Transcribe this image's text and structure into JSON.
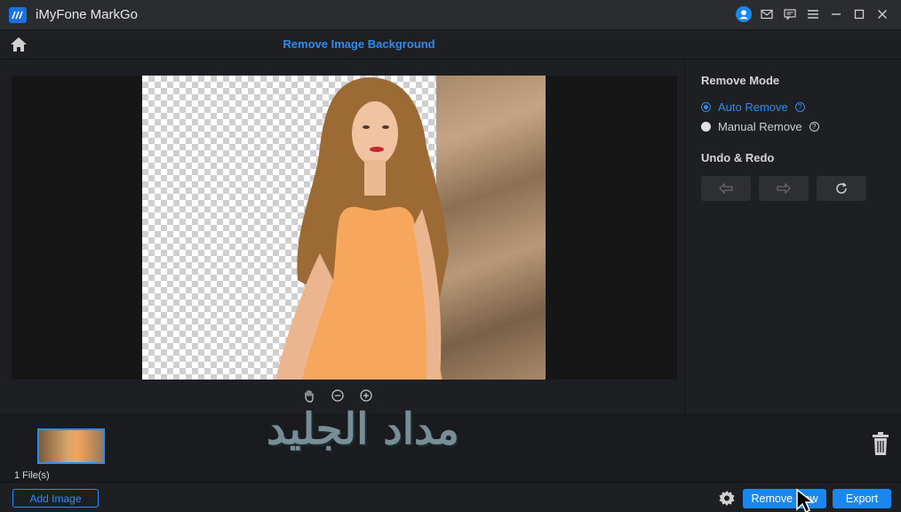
{
  "window": {
    "app_title": "iMyFone MarkGo"
  },
  "header": {
    "page_title": "Remove Image Background"
  },
  "right_panel": {
    "remove_mode_title": "Remove Mode",
    "modes": [
      {
        "label": "Auto Remove",
        "selected": true
      },
      {
        "label": "Manual Remove",
        "selected": false
      }
    ],
    "undo_redo_title": "Undo & Redo"
  },
  "file_strip": {
    "file_count": "1 File(s)"
  },
  "bottom_bar": {
    "add_image_label": "Add Image",
    "remove_now_label": "Remove Now",
    "export_label": "Export"
  },
  "watermark": {
    "text": "مداد الجليد"
  },
  "colors": {
    "accent": "#2e8cf0",
    "background": "#1e1f22",
    "titlebar": "#2b2c30"
  }
}
